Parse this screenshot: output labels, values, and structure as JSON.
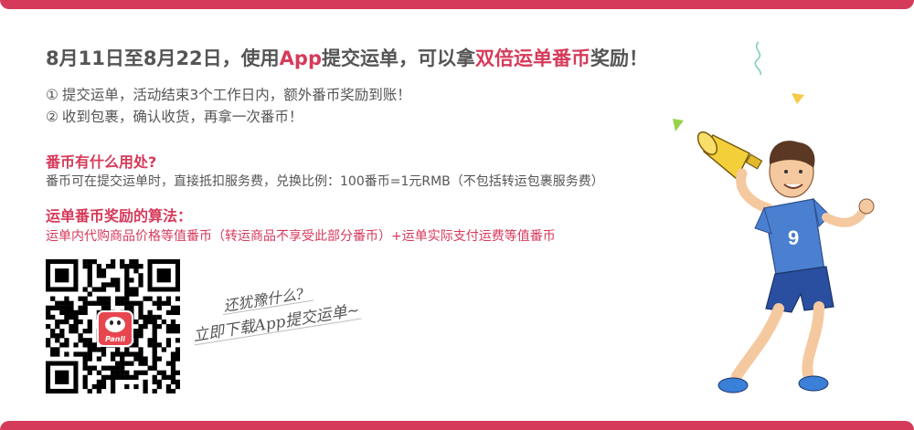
{
  "colors": {
    "accent": "#d63a5a",
    "text": "#555555"
  },
  "headline": {
    "part1": "8月11日至8月22日，使用",
    "app": "App",
    "part2": "提交运单，可以拿",
    "highlight": "双倍运单番币",
    "part3": "奖励！"
  },
  "bullets": [
    {
      "num": "①",
      "text": "提交运单，活动结束3个工作日内，额外番币奖励到账！"
    },
    {
      "num": "②",
      "text": "收到包裹，确认收货，再拿一次番币！"
    }
  ],
  "section1": {
    "title": "番币有什么用处?",
    "text": "番币可在提交运单时，直接抵扣服务费，兑换比例：100番币=1元RMB（不包括转运包裹服务费）"
  },
  "section2": {
    "title": "运单番币奖励的算法：",
    "text": "运单内代购商品价格等值番币（转运商品不享受此部分番币）+运单实际支付运费等值番币"
  },
  "qr": {
    "logo_text": "Panli"
  },
  "callout": {
    "question": "还犹豫什么?",
    "cta": "立即下载App提交运单~"
  },
  "mascot": {
    "jersey_number": "9"
  }
}
